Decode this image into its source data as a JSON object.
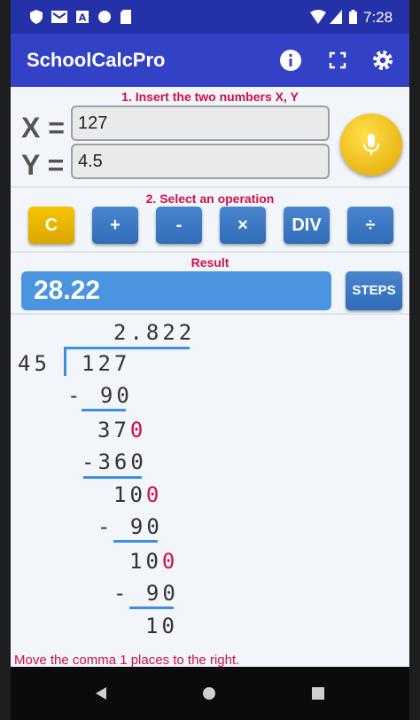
{
  "status_bar": {
    "time": "7:28",
    "icons": [
      "shield-icon",
      "mail-icon",
      "font-icon",
      "circle-icon",
      "sdcard-icon",
      "wifi-icon",
      "signal-icon",
      "battery-icon"
    ]
  },
  "app_bar": {
    "title": "SchoolCalcPro",
    "icons": [
      "info-icon",
      "fullscreen-icon",
      "settings-icon"
    ]
  },
  "input_section": {
    "label": "1. Insert the two numbers X, Y",
    "x_label": "X =",
    "x_value": "127",
    "y_label": "Y =",
    "y_value": "4.5",
    "mic_icon": "microphone-icon"
  },
  "operation_section": {
    "label": "2. Select an operation",
    "buttons": [
      "C",
      "+",
      "-",
      "×",
      "DIV",
      "÷"
    ]
  },
  "result_section": {
    "label": "Result",
    "value": "28.22",
    "steps_label": "STEPS"
  },
  "division": {
    "quotient": "2.822",
    "divisor": "45",
    "dividend": "127",
    "steps": [
      {
        "text": "- 90"
      },
      {
        "text": "37",
        "suffix": "0"
      },
      {
        "text": "-360"
      },
      {
        "text": "10",
        "suffix": "0"
      },
      {
        "text": "- 90"
      },
      {
        "text": "10",
        "suffix": "0"
      },
      {
        "text": "- 90"
      },
      {
        "text": "10"
      }
    ]
  },
  "note": "Move the comma 1 places to the right.",
  "nav_bar": {
    "icons": [
      "back-icon",
      "home-icon",
      "recents-icon"
    ]
  },
  "colors": {
    "app_bar": "#3341c7",
    "status_bar": "#2431a8",
    "accent_red": "#d0104a",
    "button_blue": "#3a78c4",
    "button_yellow": "#f2bd00",
    "result_blue": "#4a94e0"
  }
}
